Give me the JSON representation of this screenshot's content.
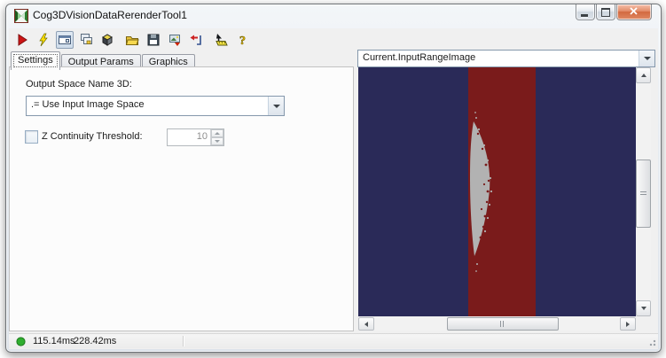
{
  "window": {
    "title": "Cog3DVisionDataRerenderTool1"
  },
  "toolbar": {
    "buttons": [
      {
        "name": "run"
      },
      {
        "name": "electric-run"
      },
      {
        "name": "float-window",
        "pressed": true
      },
      {
        "name": "copy-tool"
      },
      {
        "name": "show-3d-display"
      },
      {
        "name": "open-file"
      },
      {
        "name": "save-file"
      },
      {
        "name": "copy-image"
      },
      {
        "name": "reset-tool"
      },
      {
        "name": "measure"
      },
      {
        "name": "help"
      }
    ],
    "help_glyph": "?"
  },
  "tabs": [
    {
      "label": "Settings",
      "active": true
    },
    {
      "label": "Output Params",
      "active": false
    },
    {
      "label": "Graphics",
      "active": false
    }
  ],
  "settings": {
    "output_space_label": "Output Space Name 3D:",
    "output_space_value": ".= Use Input Image Space",
    "z_threshold_label": "Z Continuity Threshold:",
    "z_threshold_value": "10",
    "z_threshold_checked": false
  },
  "display": {
    "source": "Current.InputRangeImage"
  },
  "status": {
    "time1": "115.14ms",
    "time2": "228.42ms"
  },
  "colors": {
    "image_background": "#2a2a58",
    "image_stripe": "#7a1b1b",
    "image_sliver": "#b2b2b2",
    "status_dot": "#2fae2f"
  }
}
